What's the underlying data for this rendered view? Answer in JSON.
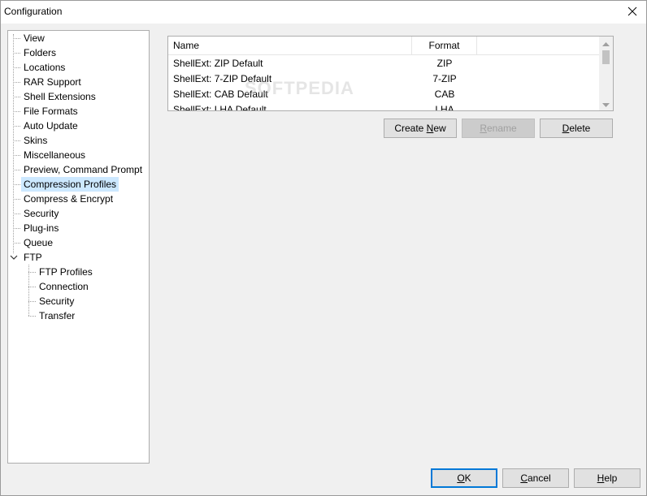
{
  "window": {
    "title": "Configuration"
  },
  "tree": {
    "items": [
      {
        "label": "View",
        "level": 0
      },
      {
        "label": "Folders",
        "level": 0
      },
      {
        "label": "Locations",
        "level": 0
      },
      {
        "label": "RAR Support",
        "level": 0
      },
      {
        "label": "Shell Extensions",
        "level": 0
      },
      {
        "label": "File Formats",
        "level": 0
      },
      {
        "label": "Auto Update",
        "level": 0
      },
      {
        "label": "Skins",
        "level": 0
      },
      {
        "label": "Miscellaneous",
        "level": 0
      },
      {
        "label": "Preview, Command Prompt",
        "level": 0
      },
      {
        "label": "Compression Profiles",
        "level": 0,
        "selected": true
      },
      {
        "label": "Compress & Encrypt",
        "level": 0
      },
      {
        "label": "Security",
        "level": 0
      },
      {
        "label": "Plug-ins",
        "level": 0
      },
      {
        "label": "Queue",
        "level": 0
      },
      {
        "label": "FTP",
        "level": 0,
        "expanded": true
      },
      {
        "label": "FTP Profiles",
        "level": 1
      },
      {
        "label": "Connection",
        "level": 1
      },
      {
        "label": "Security",
        "level": 1
      },
      {
        "label": "Transfer",
        "level": 1
      }
    ]
  },
  "profiles": {
    "columns": [
      "Name",
      "Format"
    ],
    "rows": [
      {
        "name": "ShellExt: ZIP Default",
        "format": "ZIP"
      },
      {
        "name": "ShellExt: 7-ZIP Default",
        "format": "7-ZIP"
      },
      {
        "name": "ShellExt: CAB Default",
        "format": "CAB"
      },
      {
        "name": "ShellExt: LHA Default",
        "format": "LHA"
      }
    ]
  },
  "actions": {
    "create_new": {
      "pre": "Create ",
      "key": "N",
      "post": "ew"
    },
    "rename": {
      "pre": "",
      "key": "R",
      "post": "ename"
    },
    "delete": {
      "pre": "",
      "key": "D",
      "post": "elete"
    }
  },
  "footer": {
    "ok": {
      "pre": "",
      "key": "O",
      "post": "K"
    },
    "cancel": {
      "pre": "",
      "key": "C",
      "post": "ancel"
    },
    "help": {
      "pre": "",
      "key": "H",
      "post": "elp"
    }
  },
  "watermark": "SOFTPEDIA",
  "colors": {
    "selection": "#cce8ff",
    "default_button_border": "#0078d7"
  }
}
